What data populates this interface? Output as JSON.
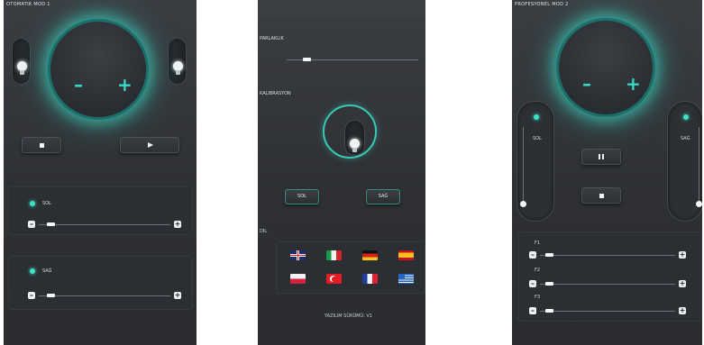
{
  "screen1": {
    "header": "OTOMATIK MOD 1",
    "knob": {
      "minus": "–",
      "plus": "+"
    },
    "buttons": {
      "stop_icon": "stop-icon",
      "play_icon": "play-icon"
    },
    "channels": [
      {
        "label": "SOL",
        "level": 0.06,
        "minus": "–",
        "plus": "+"
      },
      {
        "label": "SAĞ",
        "level": 0.06,
        "minus": "–",
        "plus": "+"
      }
    ]
  },
  "screen2": {
    "brightness_label": "PARLAKLIK",
    "brightness_level": 0.12,
    "calibration_label": "KALIBRASYON",
    "left_button": "SOL",
    "right_button": "SAĞ",
    "language_label": "DIL",
    "flags": [
      {
        "name": "uk-flag-icon"
      },
      {
        "name": "italy-flag-icon"
      },
      {
        "name": "germany-flag-icon"
      },
      {
        "name": "spain-flag-icon"
      },
      {
        "name": "poland-flag-icon"
      },
      {
        "name": "turkey-flag-icon"
      },
      {
        "name": "france-flag-icon"
      },
      {
        "name": "greece-flag-icon"
      }
    ],
    "footer": "YAZILIM SÜRÜMÜ: V1"
  },
  "screen3": {
    "header": "PROFESYONEL MOD 2",
    "knob": {
      "minus": "–",
      "plus": "+"
    },
    "left_label": "SOL",
    "right_label": "SAĞ",
    "sliders": [
      {
        "label": "F1",
        "level": 0.04,
        "minus": "–",
        "plus": "+"
      },
      {
        "label": "F2",
        "level": 0.04,
        "minus": "–",
        "plus": "+"
      },
      {
        "label": "F3",
        "level": 0.04,
        "minus": "–",
        "plus": "+"
      }
    ]
  },
  "colors": {
    "accent": "#3ee0c6",
    "background": "#2e3034"
  }
}
